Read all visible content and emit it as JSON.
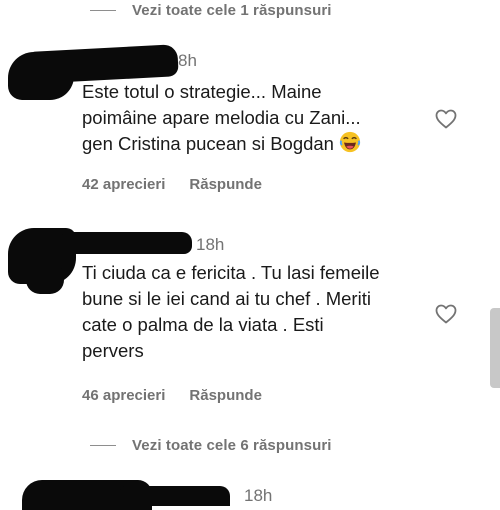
{
  "thread_top": {
    "view_replies": "Vezi toate cele 1 răspunsuri"
  },
  "comments": [
    {
      "timestamp": "8h",
      "lines": [
        "Este totul o strategie... Maine",
        "poimâine apare melodia cu Zani...",
        "gen Cristina pucean si Bogdan"
      ],
      "emoji": "laughing-face-icon",
      "likes": "42 aprecieri",
      "reply": "Răspunde"
    },
    {
      "timestamp": "18h",
      "lines": [
        "Ti ciuda ca e fericita . Tu lasi femeile",
        "bune si le iei cand ai tu chef . Meriti",
        "cate o palma de la viata . Esti",
        "pervers"
      ],
      "likes": "46 aprecieri",
      "reply": "Răspunde"
    },
    {
      "timestamp": "18h",
      "lines": []
    }
  ],
  "thread_mid": {
    "view_replies": "Vezi toate cele 6 răspunsuri"
  },
  "colors": {
    "muted": "#737373",
    "text": "#1a1a1a",
    "background": "#ffffff",
    "redaction": "#0a0a0a"
  }
}
